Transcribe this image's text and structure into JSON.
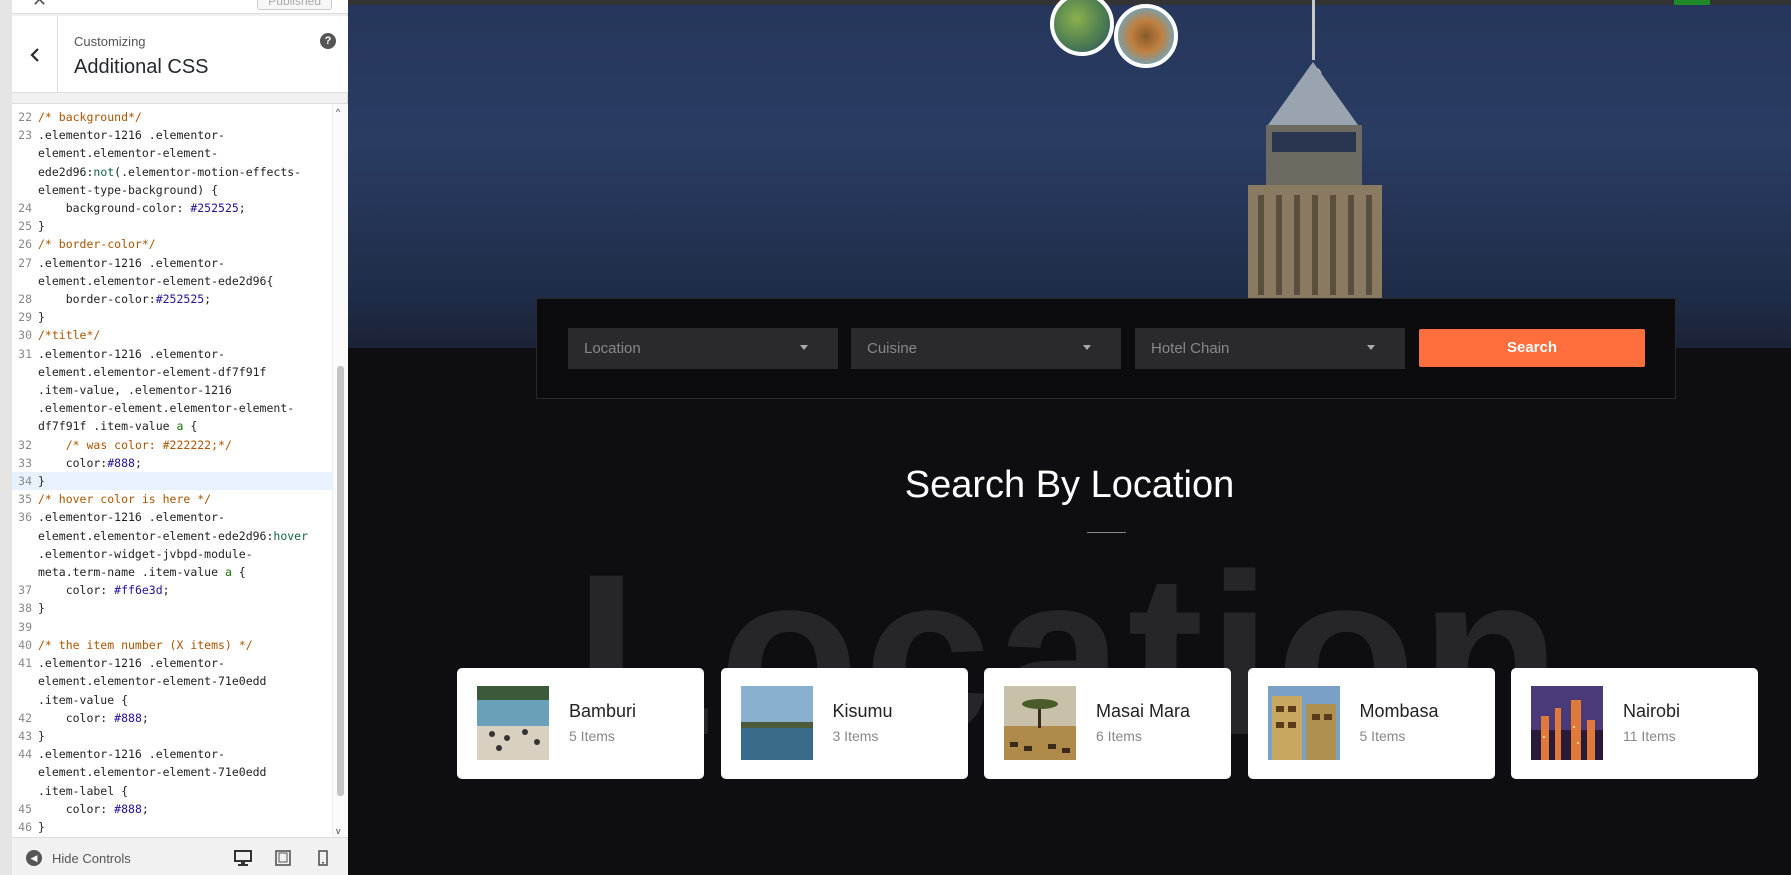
{
  "customizer": {
    "publish_label": "Published",
    "subtitle": "Customizing",
    "title": "Additional CSS",
    "help_glyph": "?",
    "hide_controls_label": "Hide Controls"
  },
  "code": [
    {
      "n": "22",
      "html": "<span class=\"t-c\">/* background*/</span>"
    },
    {
      "n": "23",
      "html": ".elementor-1216 .elementor-"
    },
    {
      "n": "",
      "html": "element.elementor-element-"
    },
    {
      "n": "",
      "html": "ede2d96:<span class=\"t-h\">not</span>(.elementor-motion-effects-"
    },
    {
      "n": "",
      "html": "element-type-background) {"
    },
    {
      "n": "24",
      "html": "    background-color: <span class=\"t-v\">#252525</span>;"
    },
    {
      "n": "25",
      "html": "}"
    },
    {
      "n": "26",
      "html": "<span class=\"t-c\">/* border-color*/</span>"
    },
    {
      "n": "27",
      "html": ".elementor-1216 .elementor-"
    },
    {
      "n": "",
      "html": "element.elementor-element-ede2d96{"
    },
    {
      "n": "28",
      "html": "    border-color:<span class=\"t-v\">#252525</span>;"
    },
    {
      "n": "29",
      "html": "}"
    },
    {
      "n": "30",
      "html": "<span class=\"t-c\">/*title*/</span>"
    },
    {
      "n": "31",
      "html": ".elementor-1216 .elementor-"
    },
    {
      "n": "",
      "html": "element.elementor-element-df7f91f"
    },
    {
      "n": "",
      "html": ".item-value, .elementor-1216"
    },
    {
      "n": "",
      "html": ".elementor-element.elementor-element-"
    },
    {
      "n": "",
      "html": "df7f91f .item-value <span class=\"t-a\">a</span> {"
    },
    {
      "n": "32",
      "html": "    <span class=\"t-c\">/* was color: #222222;*/</span>"
    },
    {
      "n": "33",
      "html": "    color:<span class=\"t-v\">#888</span>;"
    },
    {
      "n": "34",
      "html": "}",
      "active": true
    },
    {
      "n": "35",
      "html": "<span class=\"t-c\">/* hover color is here */</span>"
    },
    {
      "n": "36",
      "html": ".elementor-1216 .elementor-"
    },
    {
      "n": "",
      "html": "element.elementor-element-ede2d96:<span class=\"t-h\">hover</span>"
    },
    {
      "n": "",
      "html": ".elementor-widget-jvbpd-module-"
    },
    {
      "n": "",
      "html": "meta.term-name .item-value <span class=\"t-a\">a</span> {"
    },
    {
      "n": "37",
      "html": "    color: <span class=\"t-v\">#ff6e3d</span>;"
    },
    {
      "n": "38",
      "html": "}"
    },
    {
      "n": "39",
      "html": ""
    },
    {
      "n": "40",
      "html": "<span class=\"t-c\">/* the item number (X items) */</span>"
    },
    {
      "n": "41",
      "html": ".elementor-1216 .elementor-"
    },
    {
      "n": "",
      "html": "element.elementor-element-71e0edd"
    },
    {
      "n": "",
      "html": ".item-value {"
    },
    {
      "n": "42",
      "html": "    color: <span class=\"t-v\">#888</span>;"
    },
    {
      "n": "43",
      "html": "}"
    },
    {
      "n": "44",
      "html": ".elementor-1216 .elementor-"
    },
    {
      "n": "",
      "html": "element.elementor-element-71e0edd"
    },
    {
      "n": "",
      "html": ".item-label {"
    },
    {
      "n": "45",
      "html": "    color: <span class=\"t-v\">#888</span>;"
    },
    {
      "n": "46",
      "html": "}"
    }
  ],
  "search": {
    "location_placeholder": "Location",
    "cuisine_placeholder": "Cuisine",
    "hotel_placeholder": "Hotel Chain",
    "button_label": "Search",
    "accent_color": "#ff6e3d"
  },
  "section": {
    "title": "Search By Location",
    "background_word": "Location"
  },
  "locations": [
    {
      "name": "Bamburi",
      "count": "5 Items",
      "thumb": "beach"
    },
    {
      "name": "Kisumu",
      "count": "3 Items",
      "thumb": "lake"
    },
    {
      "name": "Masai Mara",
      "count": "6 Items",
      "thumb": "savanna"
    },
    {
      "name": "Mombasa",
      "count": "5 Items",
      "thumb": "street"
    },
    {
      "name": "Nairobi",
      "count": "11 Items",
      "thumb": "skyline"
    }
  ]
}
